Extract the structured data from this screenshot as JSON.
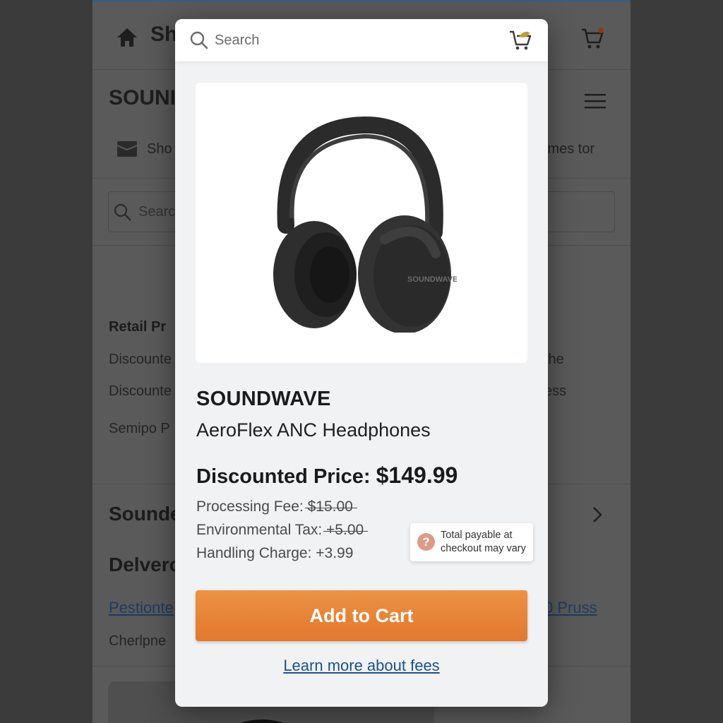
{
  "background": {
    "header_title": "Sh",
    "brand": "SOUNI",
    "shop_subtitle": "Sho",
    "times_text": "imes tor",
    "search_placeholder": "Searc",
    "retail_heading": "Retail Pr",
    "discount_line_1": "Discounte",
    "discount_line_1_right": "the",
    "discount_line_2": "Discounte",
    "discount_line_2_right": "ess",
    "semipo": "Semipo P",
    "sound_heading": "Sounde",
    "delivery_heading": "Delvero",
    "link_left": "Pestionte",
    "link_right": "0 Pruss",
    "cherlpne": "Cherlpne"
  },
  "modal": {
    "search_placeholder": "Search",
    "product": {
      "brand": "SOUNDWAVE",
      "name": "AeroFlex ANC Headphones",
      "image_logo_text": "SOUNDWAVE",
      "price_label": "Discounted Price:",
      "price_value": "$149.99"
    },
    "fees": [
      {
        "label": "Processing Fee:",
        "amount": "$15.00",
        "struck": true
      },
      {
        "label": "Environmental Tax:",
        "amount": "+5.00",
        "struck": true
      },
      {
        "label": "Handling Charge:",
        "amount": "+3.99",
        "struck": false
      }
    ],
    "tooltip": {
      "icon": "?",
      "text": "Total payable at checkout may vary"
    },
    "add_to_cart_label": "Add to Cart",
    "learn_more_label": "Learn more about fees"
  },
  "colors": {
    "accent_orange": "#e8843a",
    "link_blue": "#1e4f8f",
    "tooltip_icon": "#dc9c86",
    "cart_badge": "#c99a2e"
  }
}
